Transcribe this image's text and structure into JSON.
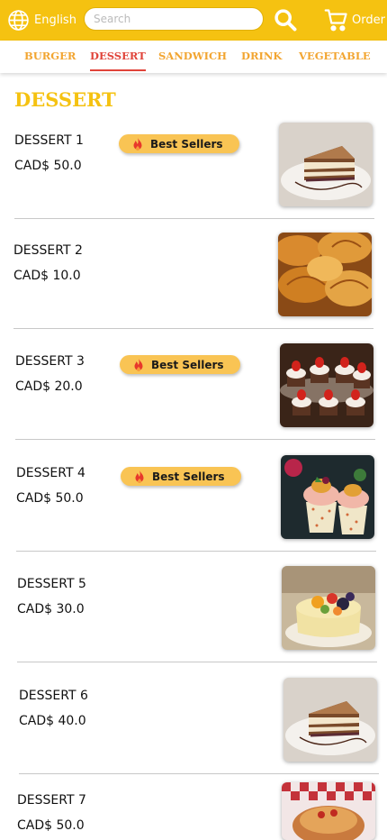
{
  "header": {
    "language_label": "English",
    "search_placeholder": "Search",
    "order_label": "Order"
  },
  "categories": [
    {
      "label": "BURGER",
      "active": false
    },
    {
      "label": "DESSERT",
      "active": true
    },
    {
      "label": "SANDWICH",
      "active": false
    },
    {
      "label": "DRINK",
      "active": false
    },
    {
      "label": "VEGETABLE",
      "active": false
    }
  ],
  "section_title": "DESSERT",
  "badge_label": "Best Sellers",
  "items": [
    {
      "name": "DESSERT 1",
      "price": "CAD$ 50.0",
      "best_seller": true,
      "image": "tiramisu"
    },
    {
      "name": "DESSERT 2",
      "price": "CAD$ 10.0",
      "best_seller": false,
      "image": "croissants"
    },
    {
      "name": "DESSERT 3",
      "price": "CAD$ 20.0",
      "best_seller": true,
      "image": "strawberry-tarts"
    },
    {
      "name": "DESSERT 4",
      "price": "CAD$ 50.0",
      "best_seller": true,
      "image": "cupcakes"
    },
    {
      "name": "DESSERT 5",
      "price": "CAD$ 30.0",
      "best_seller": false,
      "image": "fruit-cake"
    },
    {
      "name": "DESSERT 6",
      "price": "CAD$ 40.0",
      "best_seller": false,
      "image": "tiramisu"
    },
    {
      "name": "DESSERT 7",
      "price": "CAD$ 50.0",
      "best_seller": false,
      "image": "cake-on-tablecloth"
    }
  ],
  "colors": {
    "brand_yellow": "#f5c211",
    "tab_orange": "#f2a531",
    "active_red": "#e0443a",
    "badge_yellow": "#f9c454"
  },
  "icons": {
    "language": "globe-icon",
    "search": "search-icon",
    "order": "cart-icon",
    "badge": "fire-icon"
  }
}
